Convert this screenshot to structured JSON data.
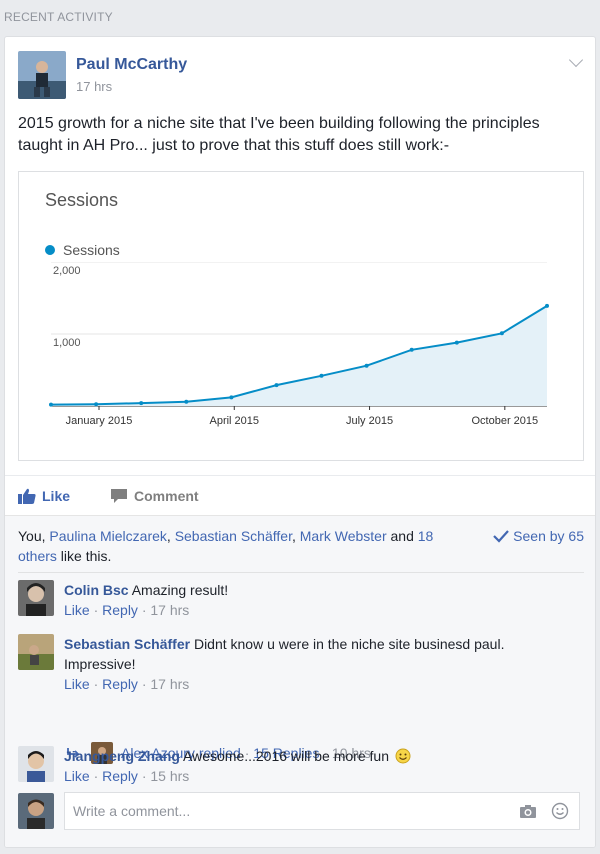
{
  "section_header": "RECENT ACTIVITY",
  "post": {
    "author": "Paul McCarthy",
    "time": "17 hrs",
    "text": "2015 growth for a niche site that I've been building following the principles taught in AH Pro... just to prove that this stuff does still work:-"
  },
  "chart_data": {
    "type": "line",
    "title": "Sessions",
    "legend": [
      "Sessions"
    ],
    "series": [
      {
        "name": "Sessions",
        "color": "#058dc7",
        "x": [
          "Jan 2015",
          "Feb 2015",
          "Mar 2015",
          "Apr 2015",
          "May 2015",
          "Jun 2015",
          "Jul 2015",
          "Aug 2015",
          "Sep 2015",
          "Oct 2015",
          "Nov 2015",
          "Dec 2015"
        ],
        "values": [
          20,
          25,
          40,
          60,
          120,
          290,
          420,
          560,
          780,
          880,
          1010,
          1390
        ]
      }
    ],
    "y_ticks": [
      "2,000",
      "1,000"
    ],
    "y_tick_values": [
      2000,
      1000
    ],
    "x_tick_labels": [
      "January 2015",
      "April 2015",
      "July 2015",
      "October 2015"
    ],
    "ylim": [
      0,
      2000
    ],
    "grid": true
  },
  "actions": {
    "like": "Like",
    "comment": "Comment"
  },
  "likes": {
    "prefix": "You, ",
    "names": [
      "Paulina Mielczarek",
      "Sebastian Schäffer",
      "Mark Webster"
    ],
    "and": " and",
    "others": "18 others",
    "suffix": " like this.",
    "seen": "Seen by 65"
  },
  "comments": [
    {
      "name": "Colin Bsc",
      "text": "Amazing result!",
      "like": "Like",
      "reply": "Reply",
      "time": "17 hrs"
    },
    {
      "name": "Sebastian Schäffer",
      "text": "Didnt know u were in the niche site businesd paul. Impressive!",
      "like": "Like",
      "reply": "Reply",
      "time": "17 hrs"
    },
    {
      "name": "Jiangpeng Zhang",
      "text": "Awesome...2016 will be more fun",
      "like": "Like",
      "reply": "Reply",
      "time": "15 hrs"
    }
  ],
  "reply_summary": {
    "replier": "Alex Azoury replied",
    "replies": "15 Replies",
    "time": "10 hrs"
  },
  "composer": {
    "placeholder": "Write a comment..."
  }
}
